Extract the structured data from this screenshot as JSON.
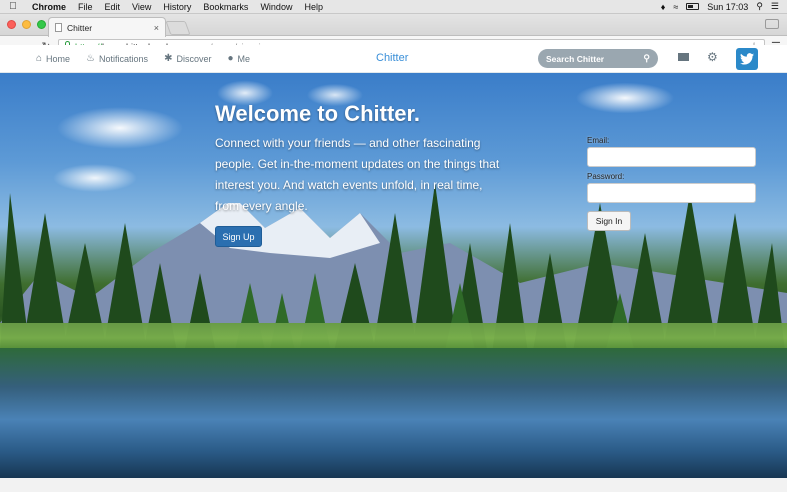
{
  "menubar": {
    "app": "Chrome",
    "items": [
      "File",
      "Edit",
      "View",
      "History",
      "Bookmarks",
      "Window",
      "Help"
    ],
    "clock": "Sun 17:03"
  },
  "browser": {
    "tab_title": "Chitter",
    "url_scheme": "https://",
    "url_host": "benschitter.herokuapp.com",
    "url_path": "/users/sign_in"
  },
  "appnav": {
    "items": [
      {
        "label": "Home",
        "icon": "home-icon"
      },
      {
        "label": "Notifications",
        "icon": "bell-icon"
      },
      {
        "label": "Discover",
        "icon": "hashtag-icon"
      },
      {
        "label": "Me",
        "icon": "user-icon"
      }
    ],
    "brand": "Chitter",
    "search_placeholder": "Search Chitter"
  },
  "hero": {
    "headline": "Welcome to Chitter.",
    "lede": "Connect with your friends — and other fascinating people. Get in-the-moment updates on the things that interest you. And watch events unfold, in real time, from every angle.",
    "signup_label": "Sign Up"
  },
  "login": {
    "email_label": "Email:",
    "email_value": "",
    "password_label": "Password:",
    "password_value": "",
    "submit_label": "Sign In"
  },
  "colors": {
    "brand": "#3a8fd8",
    "signup_bg": "#2b6fb0",
    "twitter_bg": "#2b89c9"
  }
}
